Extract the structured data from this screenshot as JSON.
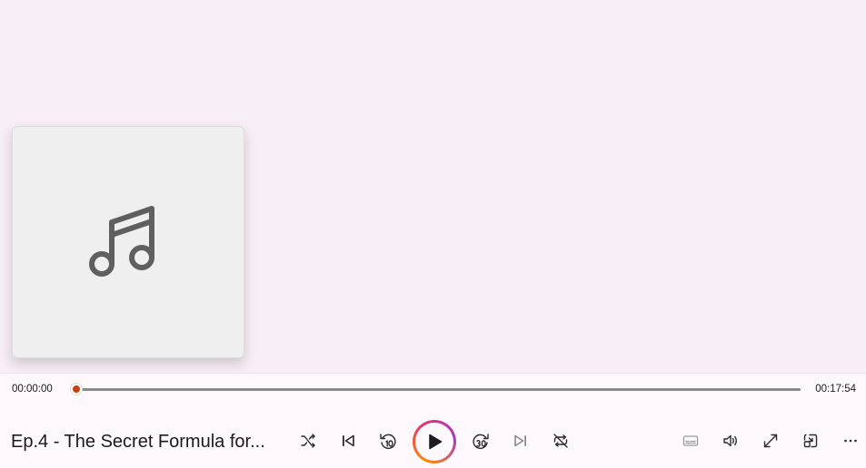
{
  "media": {
    "title": "Ep.4 - The Secret Formula for...",
    "current_time": "00:00:00",
    "duration": "00:17:54",
    "progress": 0.0
  },
  "icons": {
    "album_art": "music-note-icon",
    "shuffle": "shuffle-icon",
    "previous": "previous-track-icon",
    "rewind": "rewind-10-icon",
    "play": "play-icon",
    "forward": "forward-30-icon",
    "next": "next-track-icon",
    "repeat": "repeat-off-icon",
    "captions": "captions-icon",
    "volume": "volume-icon",
    "fullscreen": "fullscreen-icon",
    "mini_player": "mini-player-icon",
    "more": "more-options-icon"
  },
  "colors": {
    "background": "#f8eff6",
    "accent": "#c94010",
    "play_ring_start": "#ff8a00",
    "play_ring_end": "#a23cc4"
  }
}
